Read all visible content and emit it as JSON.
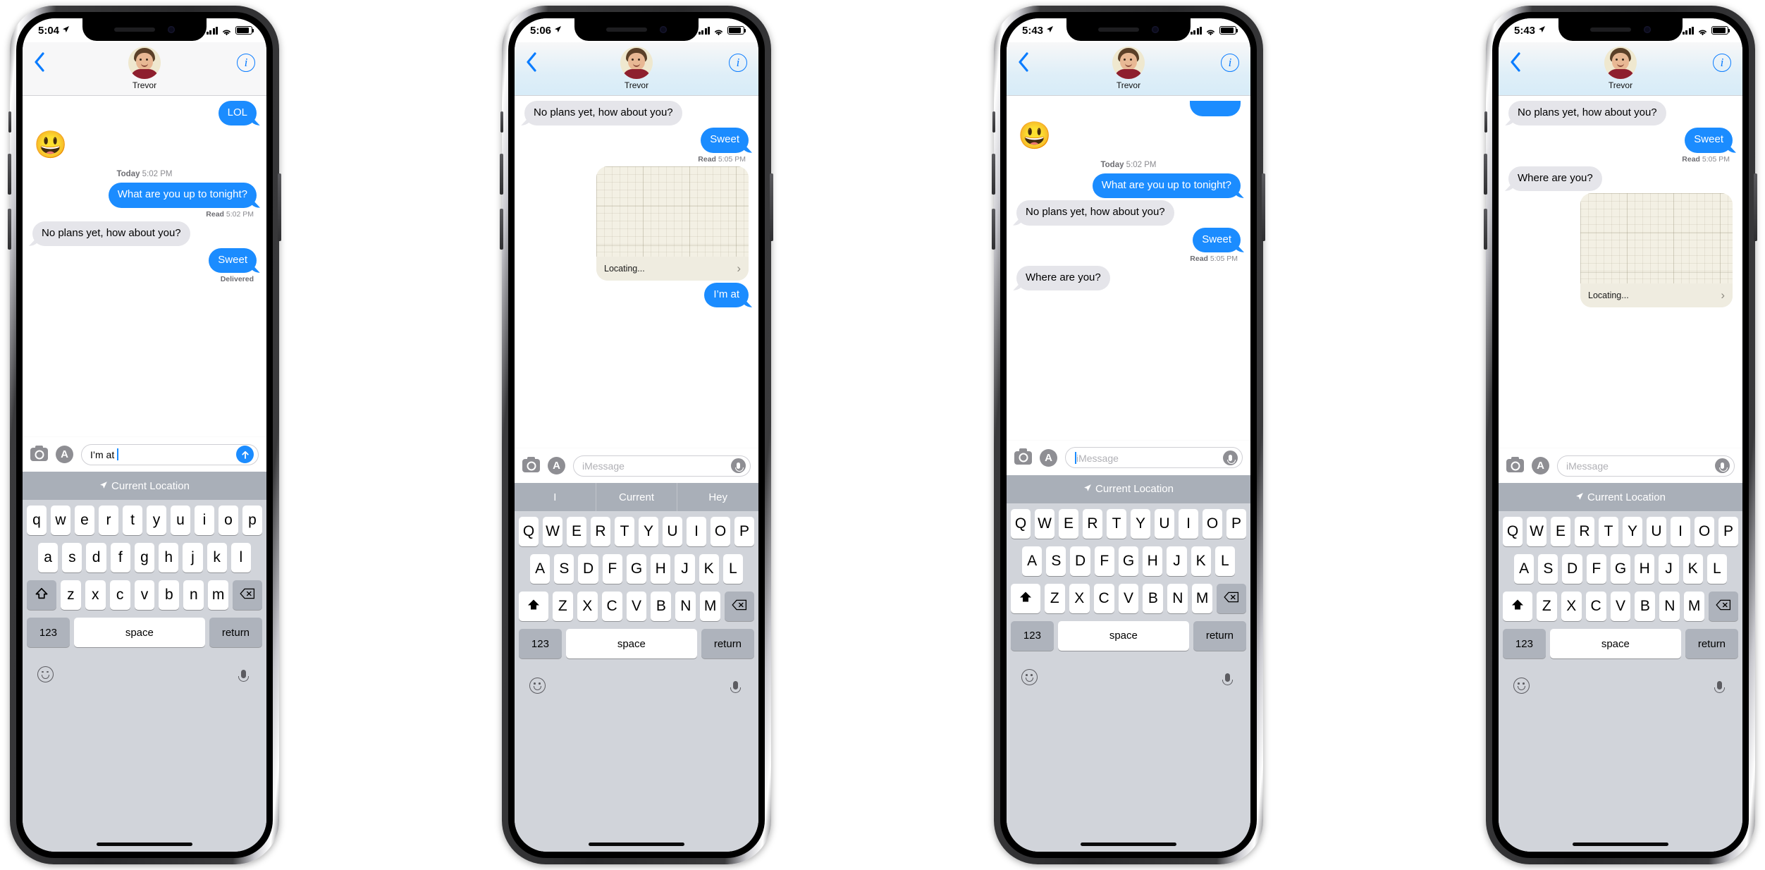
{
  "app": {
    "name": "Messages",
    "contact_name": "Trevor",
    "accent_blue": "#1b8cff",
    "bubble_gray": "#e5e5ea",
    "keyboard_bg": "#d1d4da",
    "predbar_bg": "#a9afb8"
  },
  "icons": {
    "back": "‹",
    "info": "i",
    "location_arrow": "➤",
    "chevron_right": "›",
    "send_arrow": "↑",
    "shift_outline": "⇧",
    "shift_filled": "⬆",
    "backspace": "⌫",
    "appstore": "A"
  },
  "keyboard": {
    "row1_lower": [
      "q",
      "w",
      "e",
      "r",
      "t",
      "y",
      "u",
      "i",
      "o",
      "p"
    ],
    "row2_lower": [
      "a",
      "s",
      "d",
      "f",
      "g",
      "h",
      "j",
      "k",
      "l"
    ],
    "row3_lower": [
      "z",
      "x",
      "c",
      "v",
      "b",
      "n",
      "m"
    ],
    "row1_upper": [
      "Q",
      "W",
      "E",
      "R",
      "T",
      "Y",
      "U",
      "I",
      "O",
      "P"
    ],
    "row2_upper": [
      "A",
      "S",
      "D",
      "F",
      "G",
      "H",
      "J",
      "K",
      "L"
    ],
    "row3_upper": [
      "Z",
      "X",
      "C",
      "V",
      "B",
      "N",
      "M"
    ],
    "numbers_key": "123",
    "space_key": "space",
    "return_key": "return"
  },
  "phones": [
    {
      "id": "phone-1",
      "status": {
        "time": "5:04",
        "location_active": true,
        "battery_pct": 86
      },
      "navbar_style": "plain",
      "messages": [
        {
          "type": "bubble",
          "side": "out",
          "text": "LOL"
        },
        {
          "type": "emoji",
          "side": "in",
          "text": "😃"
        },
        {
          "type": "daystamp",
          "day": "Today",
          "time": "5:02 PM"
        },
        {
          "type": "bubble",
          "side": "out",
          "text": "What are you up to tonight?"
        },
        {
          "type": "receipt",
          "label": "Read",
          "time": "5:02 PM"
        },
        {
          "type": "bubble",
          "side": "in",
          "text": "No plans yet, how about you?"
        },
        {
          "type": "bubble",
          "side": "out",
          "text": "Sweet"
        },
        {
          "type": "receipt",
          "label": "Delivered",
          "time": ""
        }
      ],
      "input": {
        "value": "I’m at ",
        "placeholder": "iMessage",
        "has_send": true,
        "show_mic": false
      },
      "predictions": [
        {
          "label": "Current Location",
          "has_arrow": true,
          "wide": true
        }
      ],
      "shift_active": false
    },
    {
      "id": "phone-2",
      "status": {
        "time": "5:06",
        "location_active": true,
        "battery_pct": 86
      },
      "navbar_style": "blurred",
      "messages": [
        {
          "type": "bubble",
          "side": "in",
          "text": "No plans yet, how about you?"
        },
        {
          "type": "bubble",
          "side": "out",
          "text": "Sweet"
        },
        {
          "type": "receipt",
          "label": "Read",
          "time": "5:05 PM"
        },
        {
          "type": "map",
          "side": "out",
          "footer": "Locating..."
        },
        {
          "type": "bubble",
          "side": "out",
          "text": "I’m at"
        }
      ],
      "input": {
        "value": "",
        "placeholder": "iMessage",
        "has_send": false,
        "show_mic": true
      },
      "predictions": [
        {
          "label": "I",
          "has_arrow": false,
          "wide": false
        },
        {
          "label": "Current",
          "has_arrow": false,
          "wide": false
        },
        {
          "label": "Hey",
          "has_arrow": false,
          "wide": false
        }
      ],
      "shift_active": true
    },
    {
      "id": "phone-3",
      "status": {
        "time": "5:43",
        "location_active": true,
        "battery_pct": 90
      },
      "navbar_style": "blurred",
      "messages": [
        {
          "type": "partial-out",
          "text": ""
        },
        {
          "type": "emoji",
          "side": "in",
          "text": "😃"
        },
        {
          "type": "daystamp",
          "day": "Today",
          "time": "5:02 PM"
        },
        {
          "type": "bubble",
          "side": "out",
          "text": "What are you up to tonight?"
        },
        {
          "type": "bubble",
          "side": "in",
          "text": "No plans yet, how about you?"
        },
        {
          "type": "bubble",
          "side": "out",
          "text": "Sweet"
        },
        {
          "type": "receipt",
          "label": "Read",
          "time": "5:05 PM"
        },
        {
          "type": "bubble",
          "side": "in",
          "text": "Where are you?"
        }
      ],
      "input": {
        "value": "",
        "placeholder": "iMessage",
        "has_send": false,
        "show_mic": true,
        "focused": true
      },
      "predictions": [
        {
          "label": "Current Location",
          "has_arrow": true,
          "wide": true
        }
      ],
      "shift_active": true
    },
    {
      "id": "phone-4",
      "status": {
        "time": "5:43",
        "location_active": true,
        "battery_pct": 90
      },
      "navbar_style": "blurred",
      "messages": [
        {
          "type": "bubble",
          "side": "in",
          "text": "No plans yet, how about you?"
        },
        {
          "type": "bubble",
          "side": "out",
          "text": "Sweet"
        },
        {
          "type": "receipt",
          "label": "Read",
          "time": "5:05 PM"
        },
        {
          "type": "bubble",
          "side": "in",
          "text": "Where are you?"
        },
        {
          "type": "map",
          "side": "out",
          "footer": "Locating..."
        }
      ],
      "input": {
        "value": "",
        "placeholder": "iMessage",
        "has_send": false,
        "show_mic": true
      },
      "predictions": [
        {
          "label": "Current Location",
          "has_arrow": true,
          "wide": true
        }
      ],
      "shift_active": true
    }
  ]
}
